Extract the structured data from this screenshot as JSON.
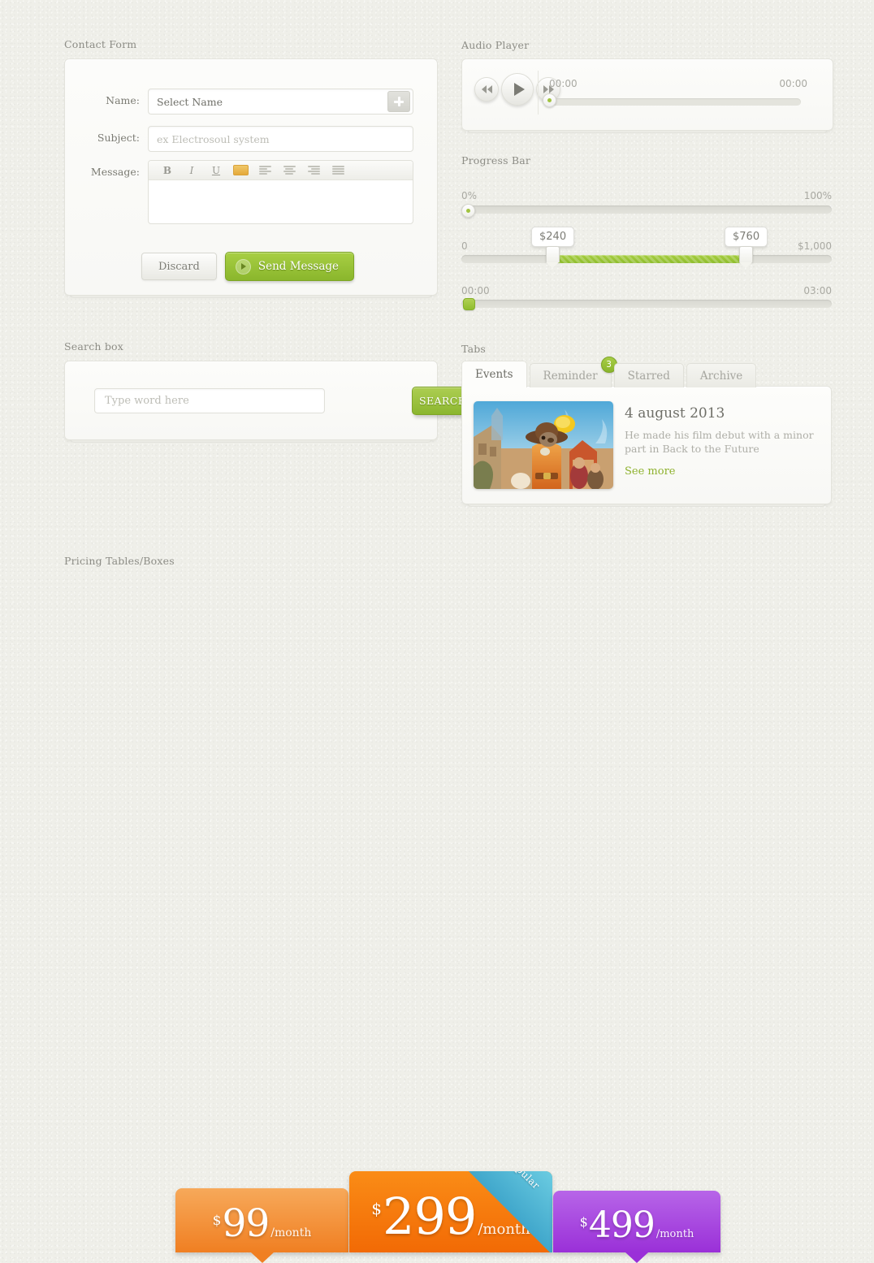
{
  "sections": {
    "contact_form": "Contact Form",
    "search_box": "Search box",
    "audio_player": "Audio Player",
    "progress_bar": "Progress Bar",
    "tabs": "Tabs",
    "pricing": "Pricing Tables/Boxes"
  },
  "contact_form": {
    "name_label": "Name:",
    "name_value": "Select Name",
    "add_button_icon": "plus-icon",
    "subject_label": "Subject:",
    "subject_placeholder": "ex Electrosoul system",
    "message_label": "Message:",
    "toolbar": {
      "bold": "B",
      "italic": "I",
      "underline": "U",
      "color_swatch": "#e9b44c",
      "align_left_icon": "align-left-icon",
      "align_center_icon": "align-center-icon",
      "align_right_icon": "align-right-icon",
      "align_justify_icon": "align-justify-icon"
    },
    "message_value": "",
    "discard_label": "Discard",
    "send_label": "Send Message"
  },
  "search_box": {
    "placeholder": "Type word here",
    "value": "",
    "button_label": "SEARCH"
  },
  "audio_player": {
    "rewind_icon": "rewind-icon",
    "play_icon": "play-icon",
    "forward_icon": "fast-forward-icon",
    "time_current": "00:00",
    "time_total": "00:00",
    "progress_percent": 0
  },
  "progress_bar": {
    "slider_percent": {
      "min_label": "0%",
      "max_label": "100%",
      "value_percent": 0
    },
    "slider_range": {
      "min_label": "0",
      "max_label": "$1,000",
      "low_tooltip": "$240",
      "high_tooltip": "$760",
      "low_percent": 24,
      "high_percent": 76
    },
    "slider_time": {
      "min_label": "00:00",
      "max_label": "03:00",
      "value_percent": 0
    }
  },
  "tabs": {
    "items": [
      {
        "label": "Events",
        "active": true,
        "badge": ""
      },
      {
        "label": "Reminder",
        "active": false,
        "badge": "3"
      },
      {
        "label": "Starred",
        "active": false,
        "badge": ""
      },
      {
        "label": "Archive",
        "active": false,
        "badge": ""
      }
    ],
    "content": {
      "thumbnail_name": "event-thumbnail-image",
      "title": "4 august 2013",
      "description": "He made his film debut with a minor part in Back to the Future",
      "link": "See more"
    }
  },
  "pricing": {
    "boxes": [
      {
        "currency": "$",
        "amount": "99",
        "period": "/month",
        "color": "#f07f22",
        "badge": ""
      },
      {
        "currency": "$",
        "amount": "299",
        "period": "/month",
        "color": "#f26a05",
        "badge": "Most Popular"
      },
      {
        "currency": "$",
        "amount": "499",
        "period": "/month",
        "color": "#9a30d8",
        "badge": ""
      }
    ]
  }
}
